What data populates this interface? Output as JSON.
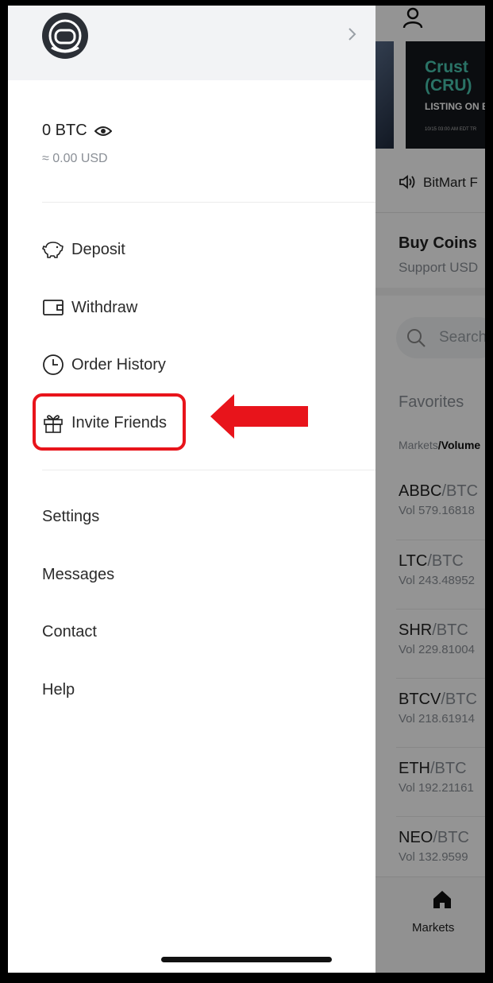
{
  "drawer": {
    "balance": {
      "value": "0 BTC",
      "usd": "≈ 0.00 USD"
    },
    "primary_items": [
      {
        "label": "Deposit",
        "icon": "piggy-bank-icon"
      },
      {
        "label": "Withdraw",
        "icon": "wallet-icon"
      },
      {
        "label": "Order History",
        "icon": "clock-icon"
      },
      {
        "label": "Invite Friends",
        "icon": "gift-icon"
      }
    ],
    "secondary_items": [
      {
        "label": "Settings"
      },
      {
        "label": "Messages"
      },
      {
        "label": "Contact"
      },
      {
        "label": "Help"
      }
    ]
  },
  "background_app": {
    "banner": {
      "title_line1": "Crust",
      "title_line2": "(CRU)",
      "subtitle": "LISTING ON B",
      "date": "10/15 03:00 AM EDT TR"
    },
    "announcement": "BitMart F",
    "buy_coins": {
      "title": "Buy Coins",
      "subtitle": "Support USD"
    },
    "search_placeholder": "Search",
    "favorites_label": "Favorites",
    "sort": {
      "markets": "Markets",
      "volume": "/Volume"
    },
    "markets": [
      {
        "base": "ABBC",
        "quote": "/BTC",
        "vol": "Vol 579.16818"
      },
      {
        "base": "LTC",
        "quote": "/BTC",
        "vol": "Vol 243.48952"
      },
      {
        "base": "SHR",
        "quote": "/BTC",
        "vol": "Vol 229.81004"
      },
      {
        "base": "BTCV",
        "quote": "/BTC",
        "vol": "Vol 218.61914"
      },
      {
        "base": "ETH",
        "quote": "/BTC",
        "vol": "Vol 192.21161"
      },
      {
        "base": "NEO",
        "quote": "/BTC",
        "vol": "Vol 132.9599"
      }
    ],
    "bottom_tab": {
      "label": "Markets"
    }
  },
  "colors": {
    "highlight": "#e8141b",
    "text_primary": "#222222",
    "text_secondary": "#8a8f96"
  }
}
